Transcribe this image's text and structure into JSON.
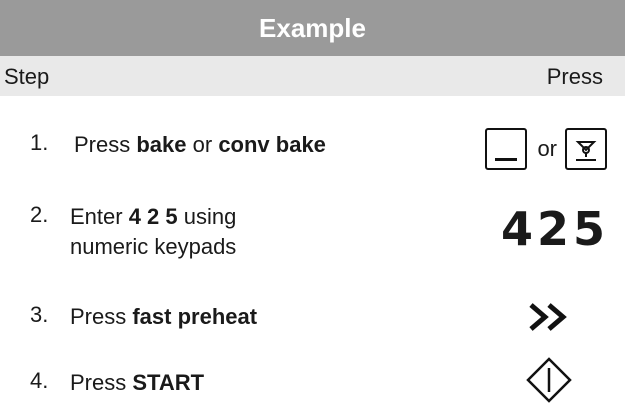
{
  "header": {
    "title": "Example"
  },
  "columns": {
    "step": "Step",
    "press": "Press"
  },
  "steps": [
    {
      "num": "1.",
      "pre": "Press ",
      "b1": "bake",
      "mid": " or ",
      "b2": "conv bake",
      "press": {
        "icons": [
          "bake-key-icon",
          "conv-bake-fan-icon"
        ],
        "or": "or"
      }
    },
    {
      "num": "2.",
      "pre": "Enter ",
      "b1": "4 2 5",
      "post": " using",
      "line2": "numeric keypads",
      "press": {
        "display": "425"
      }
    },
    {
      "num": "3.",
      "pre": "Press ",
      "b1": "fast preheat",
      "press": {
        "icon": "fast-preheat-double-chevron-icon"
      }
    },
    {
      "num": "4.",
      "pre": "Press ",
      "b1": "START",
      "press": {
        "icon": "start-diamond-icon"
      }
    }
  ]
}
